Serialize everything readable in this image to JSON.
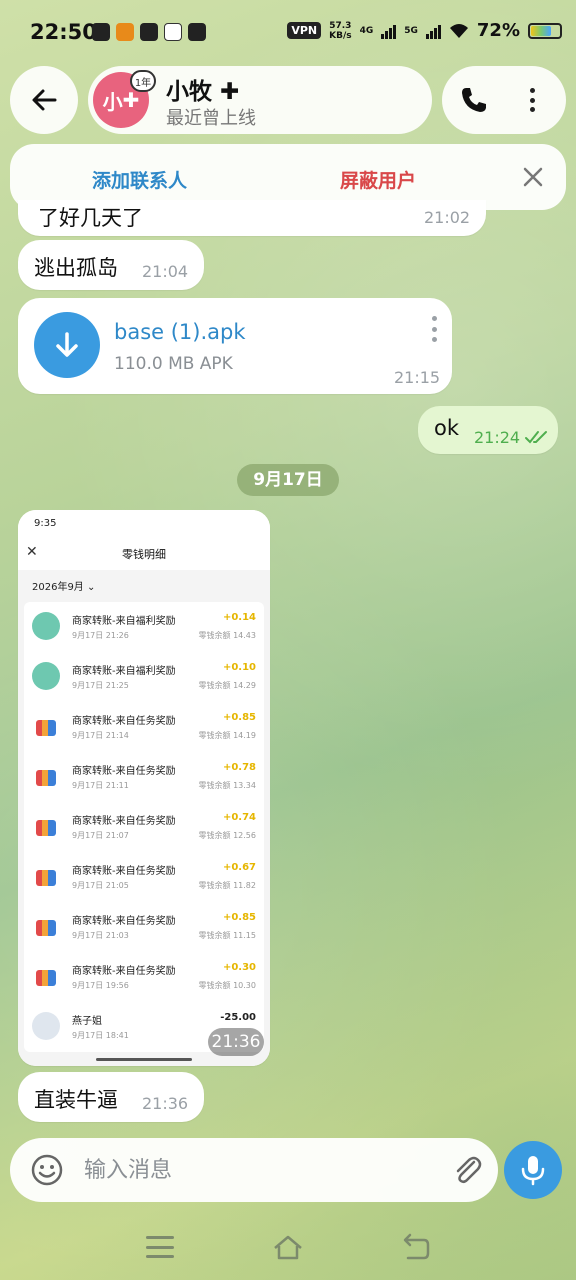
{
  "status_bar": {
    "time": "22:50",
    "vpn": "VPN",
    "net_speed_value": "57.3",
    "net_speed_unit": "KB/s",
    "signal_1": "4G",
    "signal_2": "5G",
    "battery": "72%"
  },
  "header": {
    "avatar_text": "小",
    "avatar_badge": "1年",
    "contact_name": "小牧 ✚",
    "contact_status": "最近曾上线"
  },
  "banner": {
    "add_contact": "添加联系人",
    "block_user": "屏蔽用户"
  },
  "messages": {
    "partial": {
      "text": "了好几天了",
      "time": "21:02"
    },
    "escape": {
      "text": "逃出孤岛",
      "time": "21:04"
    },
    "file": {
      "name": "base (1).apk",
      "size": "110.0 MB APK",
      "time": "21:15"
    },
    "outgoing": {
      "text": "ok",
      "time": "21:24"
    },
    "date_separator": "9月17日",
    "image_time": "21:36",
    "last": {
      "text": "直装牛逼",
      "time": "21:36"
    }
  },
  "screenshot": {
    "time": "9:35",
    "title": "零钱明细",
    "close": "✕",
    "month": "2026年9月 ⌄",
    "rows": [
      {
        "title": "商家转账-来自福利奖励",
        "date": "9月17日 21:26",
        "amount": "+0.14",
        "balance": "零钱余额 14.43",
        "icon": "welfare"
      },
      {
        "title": "商家转账-来自福利奖励",
        "date": "9月17日 21:25",
        "amount": "+0.10",
        "balance": "零钱余额 14.29",
        "icon": "welfare"
      },
      {
        "title": "商家转账-来自任务奖励",
        "date": "9月17日 21:14",
        "amount": "+0.85",
        "balance": "零钱余额 14.19",
        "icon": "task"
      },
      {
        "title": "商家转账-来自任务奖励",
        "date": "9月17日 21:11",
        "amount": "+0.78",
        "balance": "零钱余额 13.34",
        "icon": "task"
      },
      {
        "title": "商家转账-来自任务奖励",
        "date": "9月17日 21:07",
        "amount": "+0.74",
        "balance": "零钱余额 12.56",
        "icon": "task"
      },
      {
        "title": "商家转账-来自任务奖励",
        "date": "9月17日 21:05",
        "amount": "+0.67",
        "balance": "零钱余额 11.82",
        "icon": "task"
      },
      {
        "title": "商家转账-来自任务奖励",
        "date": "9月17日 21:03",
        "amount": "+0.85",
        "balance": "零钱余额 11.15",
        "icon": "task"
      },
      {
        "title": "商家转账-来自任务奖励",
        "date": "9月17日 19:56",
        "amount": "+0.30",
        "balance": "零钱余额 10.30",
        "icon": "task"
      },
      {
        "title": "燕子姐",
        "date": "9月17日 18:41",
        "amount": "-25.00",
        "balance": "",
        "icon": "person"
      }
    ]
  },
  "composer": {
    "placeholder": "输入消息"
  },
  "colors": {
    "accent": "#3a9be0",
    "link": "#2e88c8",
    "danger": "#d9484a",
    "outgoing_bubble": "#e4f6d1"
  }
}
